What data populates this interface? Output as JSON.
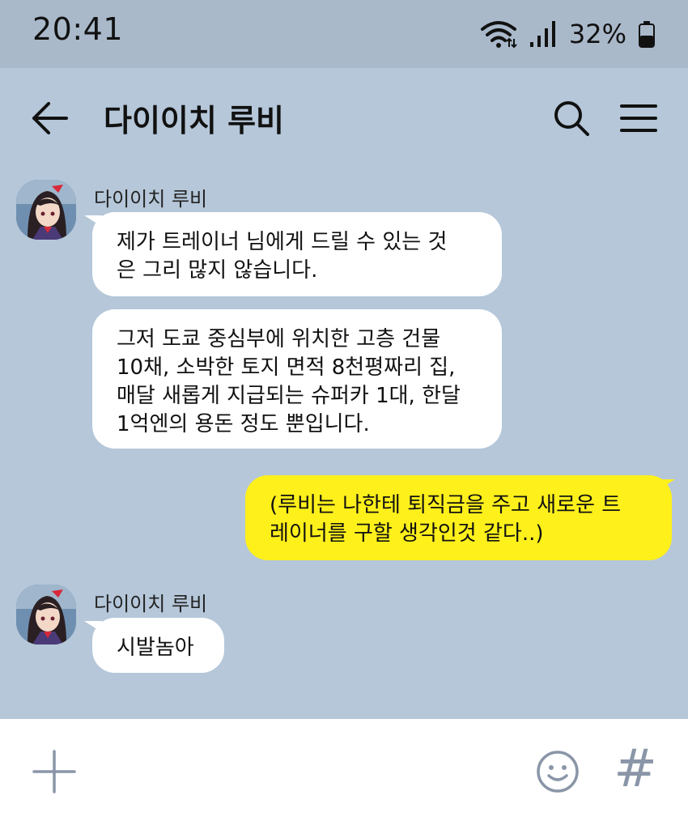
{
  "status_bar": {
    "time": "20:41",
    "battery_percent": "32%",
    "icons": [
      "wifi-icon",
      "signal-icon",
      "battery-icon"
    ]
  },
  "header": {
    "title": "다이이치 루비",
    "icons": [
      "back-arrow-icon",
      "search-icon",
      "menu-icon"
    ]
  },
  "messages": [
    {
      "sender": "다이이치 루비",
      "bubbles": [
        "제가 트레이너 님에게 드릴 수 있는 것\n은 그리 많지 않습니다.",
        "그저 도쿄 중심부에 위치한 고층 건물\n10채, 소박한 토지 면적 8천평짜리 집,\n매달 새롭게 지급되는 슈퍼카 1대, 한달\n1억엔의 용돈 정도 뿐입니다."
      ]
    },
    {
      "sender": "me",
      "bubbles": [
        "(루비는 나한테 퇴직금을 주고 새로운 트\n레이너를 구할 생각인것 같다..)"
      ]
    },
    {
      "sender": "다이이치 루비",
      "bubbles": [
        "시발놈아"
      ]
    }
  ],
  "input_bar": {
    "icons": [
      "plus-icon",
      "emoji-icon",
      "hashtag-icon"
    ],
    "hash_glyph": "#"
  },
  "colors": {
    "background": "#b5c7d9",
    "status_bar": "#a9b9ca",
    "incoming_bubble": "#ffffff",
    "outgoing_bubble": "#fef01b"
  }
}
